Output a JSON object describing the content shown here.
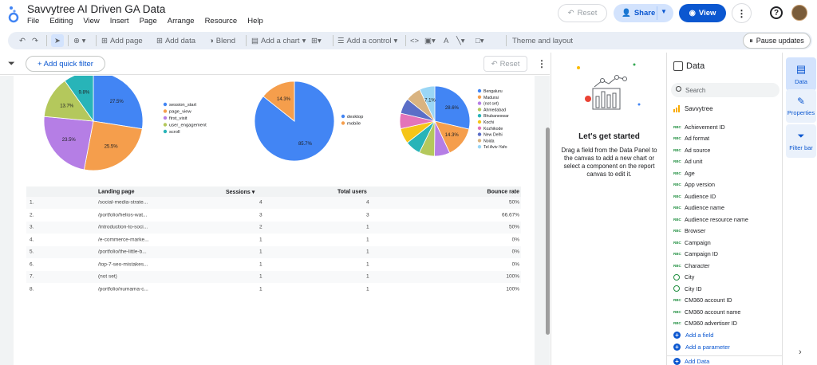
{
  "app": {
    "title": "Savvytree AI Driven GA Data",
    "menus": [
      "File",
      "Editing",
      "View",
      "Insert",
      "Page",
      "Arrange",
      "Resource",
      "Help"
    ],
    "reset_label": "Reset",
    "share_label": "Share",
    "view_label": "View"
  },
  "toolbar": {
    "add_page": "Add page",
    "add_data": "Add data",
    "blend": "Blend",
    "add_chart": "Add a chart",
    "add_control": "Add a control",
    "theme_layout": "Theme and layout",
    "pause_updates": "Pause updates"
  },
  "filterbar": {
    "quick_filter": "+ Add quick filter",
    "reset": "Reset"
  },
  "charts": {
    "chart_data": [
      {
        "type": "pie",
        "categories": [
          "session_start",
          "page_view",
          "first_visit",
          "user_engagement",
          "scroll"
        ],
        "values": [
          27.5,
          25.5,
          23.5,
          13.7,
          9.8
        ],
        "labels": [
          "27.5%",
          "25.5%",
          "23.5%",
          "13.7%",
          "9.8%"
        ],
        "colors": [
          "#4285f4",
          "#f59e4c",
          "#b57ee5",
          "#b4c85c",
          "#28b4b8"
        ],
        "legend": "right"
      },
      {
        "type": "pie",
        "categories": [
          "desktop",
          "mobile"
        ],
        "values": [
          85.7,
          14.3
        ],
        "labels": [
          "85.7%",
          "14.3%"
        ],
        "colors": [
          "#4285f4",
          "#f59e4c"
        ],
        "legend": "right"
      },
      {
        "type": "pie",
        "categories": [
          "Bengaluru",
          "Madurai",
          "(not set)",
          "Ahmedabad",
          "Bhubaneswar",
          "Kochi",
          "Kozhikode",
          "New Delhi",
          "Noida",
          "Tel Aviv-Yafo"
        ],
        "values": [
          28.6,
          14.3,
          7.1,
          7.1,
          7.1,
          7.1,
          7.1,
          7.1,
          7.1,
          7.1
        ],
        "labels": [
          "28.6%",
          "14.3%",
          "",
          "",
          "",
          "",
          "",
          "",
          "",
          "7.1%"
        ],
        "colors": [
          "#4285f4",
          "#f59e4c",
          "#b57ee5",
          "#b4c85c",
          "#28b4b8",
          "#f5c518",
          "#e374b9",
          "#5b6ec7",
          "#d9b380",
          "#9ad6f5"
        ],
        "legend": "right"
      }
    ]
  },
  "table": {
    "headers": [
      "Landing page",
      "Sessions",
      "Total users",
      "Bounce rate"
    ],
    "sort_indicator": "▾",
    "rows": [
      {
        "n": "1.",
        "page": "/social-media-strate...",
        "sessions": "4",
        "users": "4",
        "bounce": "50%"
      },
      {
        "n": "2.",
        "page": "/portfolio/helios-wat...",
        "sessions": "3",
        "users": "3",
        "bounce": "66.67%"
      },
      {
        "n": "3.",
        "page": "/introduction-to-soci...",
        "sessions": "2",
        "users": "1",
        "bounce": "50%"
      },
      {
        "n": "4.",
        "page": "/e-commerce-marke...",
        "sessions": "1",
        "users": "1",
        "bounce": "0%"
      },
      {
        "n": "5.",
        "page": "/portfolio/the-little-b...",
        "sessions": "1",
        "users": "1",
        "bounce": "0%"
      },
      {
        "n": "6.",
        "page": "/top-7-seo-mistakes...",
        "sessions": "1",
        "users": "1",
        "bounce": "0%"
      },
      {
        "n": "7.",
        "page": "(not set)",
        "sessions": "1",
        "users": "1",
        "bounce": "100%"
      },
      {
        "n": "8.",
        "page": "/portfolio/numama-c...",
        "sessions": "1",
        "users": "1",
        "bounce": "100%"
      }
    ]
  },
  "start_panel": {
    "title": "Let's get started",
    "description": "Drag a field from the Data Panel to the canvas to add a new chart or select a component on the report canvas to edit it."
  },
  "data_panel": {
    "title": "Data",
    "search_placeholder": "Search",
    "source": "Savvytree",
    "fields": [
      {
        "name": "Achievement ID",
        "type": "text"
      },
      {
        "name": "Ad format",
        "type": "text"
      },
      {
        "name": "Ad source",
        "type": "text"
      },
      {
        "name": "Ad unit",
        "type": "text"
      },
      {
        "name": "Age",
        "type": "text"
      },
      {
        "name": "App version",
        "type": "text"
      },
      {
        "name": "Audience ID",
        "type": "text"
      },
      {
        "name": "Audience name",
        "type": "text"
      },
      {
        "name": "Audience resource name",
        "type": "text"
      },
      {
        "name": "Browser",
        "type": "text"
      },
      {
        "name": "Campaign",
        "type": "text"
      },
      {
        "name": "Campaign ID",
        "type": "text"
      },
      {
        "name": "Character",
        "type": "text"
      },
      {
        "name": "City",
        "type": "geo"
      },
      {
        "name": "City ID",
        "type": "geo"
      },
      {
        "name": "CM360 account ID",
        "type": "text"
      },
      {
        "name": "CM360 account name",
        "type": "text"
      },
      {
        "name": "CM360 advertiser ID",
        "type": "text"
      }
    ],
    "add_field": "Add a field",
    "add_parameter": "Add a parameter",
    "add_data": "Add Data",
    "abc": "RBC"
  },
  "rail": {
    "data": "Data",
    "properties": "Properties",
    "filter_bar": "Filter bar"
  }
}
